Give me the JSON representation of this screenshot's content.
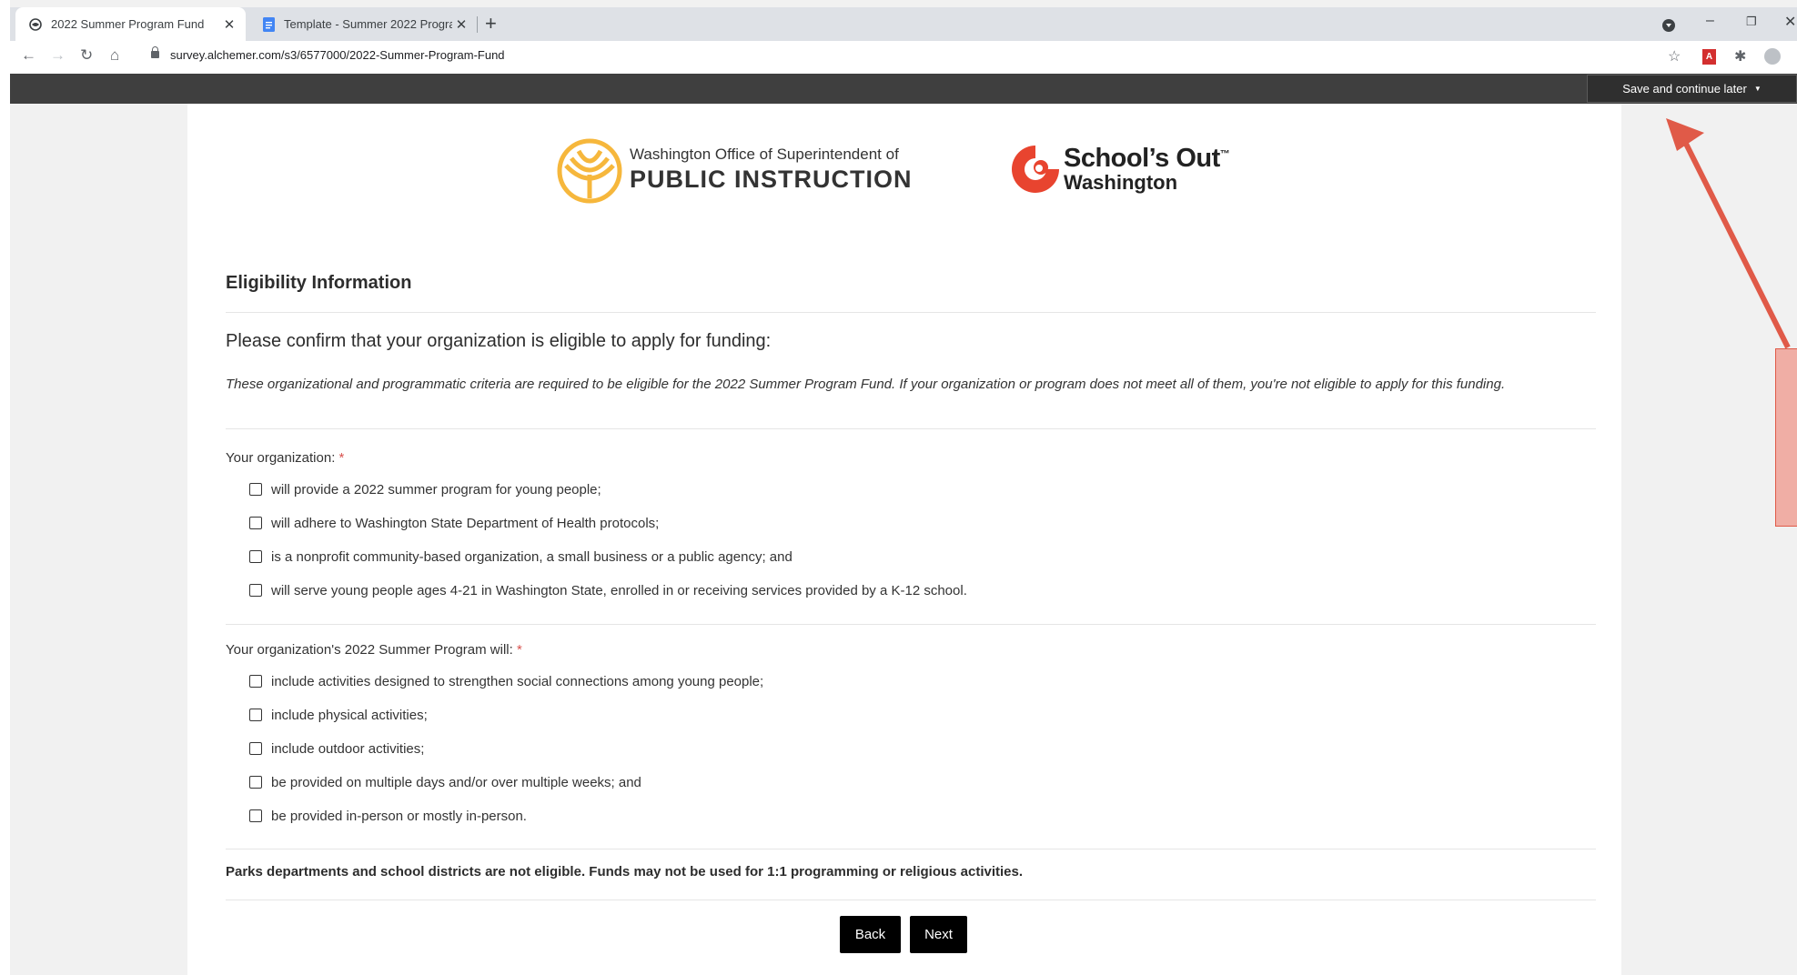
{
  "browser": {
    "tabs": [
      {
        "label": "2022 Summer Program Fund",
        "close": "✕"
      },
      {
        "label": "Template - Summer 2022 Progra",
        "close": "✕"
      }
    ],
    "new_tab": "+",
    "url": "survey.alchemer.com/s3/6577000/2022-Summer-Program-Fund"
  },
  "header": {
    "save_label": "Save and continue later"
  },
  "logos": {
    "ospi_line1": "Washington Office of Superintendent of",
    "ospi_line2": "PUBLIC INSTRUCTION",
    "so_line1": "School’s Out",
    "so_tm": "™",
    "so_line2": "Washington"
  },
  "form": {
    "section_title": "Eligibility Information",
    "question_title": "Please confirm that your organization is eligible to apply for funding:",
    "intro": "These organizational and programmatic criteria are required to be eligible for the 2022 Summer Program Fund. If your organization or program does not meet all of them, you're not eligible to apply for this funding.",
    "q1": {
      "label": "Your organization:",
      "required": "*",
      "options": [
        "will provide a 2022 summer program for young people;",
        "will adhere to Washington State Department of Health protocols;",
        "is a nonprofit community-based organization, a small business or a public agency; and",
        "will serve young people ages 4-21 in Washington State, enrolled in or receiving services provided by a K-12 school."
      ]
    },
    "q2": {
      "label": "Your organization's 2022 Summer Program will:",
      "required": "*",
      "options": [
        "include activities designed to strengthen social connections among young people;",
        "include physical activities;",
        "include outdoor activities;",
        "be provided on multiple days and/or over multiple weeks; and",
        "be provided in-person or mostly in-person."
      ]
    },
    "disclaimer": "Parks departments and school districts are not eligible. Funds may not be used for 1:1 programming or religious activities.",
    "back_label": "Back",
    "next_label": "Next"
  },
  "colors": {
    "header_bar": "#3f3f3f",
    "annotation": "#e05a48",
    "required": "#d9534f"
  }
}
